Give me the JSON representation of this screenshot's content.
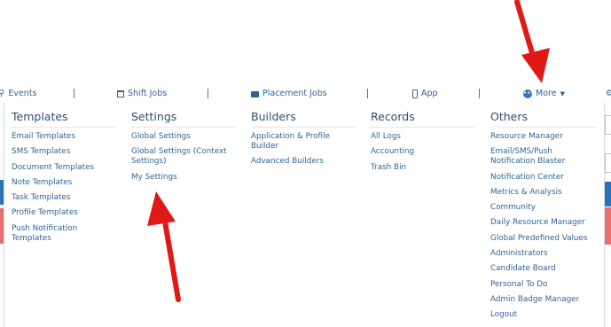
{
  "nav": {
    "events": "Events",
    "shift_jobs": "Shift Jobs",
    "placement_jobs": "Placement Jobs",
    "app": "App",
    "more": "More"
  },
  "menu": {
    "templates": {
      "title": "Templates",
      "items": [
        "Email Templates",
        "SMS Templates",
        "Document Templates",
        "Note Templates",
        "Task Templates",
        "Profile Templates",
        "Push Notification Templates"
      ]
    },
    "settings": {
      "title": "Settings",
      "items": [
        "Global Settings",
        "Global Settings (Context Settings)",
        "My Settings"
      ]
    },
    "builders": {
      "title": "Builders",
      "items": [
        "Application & Profile Builder",
        "Advanced Builders"
      ]
    },
    "records": {
      "title": "Records",
      "items": [
        "All Logs",
        "Accounting",
        "Trash Bin"
      ]
    },
    "others": {
      "title": "Others",
      "items": [
        "Resource Manager",
        "Email/SMS/Push Notification Blaster",
        "Notification Center",
        "Metrics & Analysis",
        "Community",
        "Daily Resource Manager",
        "Global Predefined Values",
        "Administrators",
        "Candidate Board",
        "Personal To Do",
        "Admin Badge Manager",
        "Logout"
      ]
    }
  },
  "colors": {
    "link": "#2e6496",
    "heading": "#2b4f74",
    "arrow": "#e01818"
  }
}
